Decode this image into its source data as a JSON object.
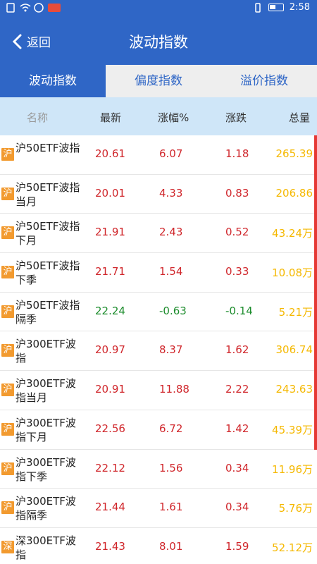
{
  "status_bar": {
    "time": "2:58"
  },
  "nav": {
    "back_label": "返回",
    "title": "波动指数"
  },
  "tabs": [
    {
      "label": "波动指数",
      "active": true
    },
    {
      "label": "偏度指数",
      "active": false
    },
    {
      "label": "溢价指数",
      "active": false
    }
  ],
  "table": {
    "headers": {
      "name": "名称",
      "latest": "最新",
      "pct": "涨幅%",
      "change": "涨跌",
      "volume": "总量"
    },
    "rows": [
      {
        "tag": "沪",
        "name": "沪50ETF波指",
        "latest": "20.61",
        "pct": "6.07",
        "change": "1.18",
        "volume": "265.39",
        "dir": "up"
      },
      {
        "tag": "沪",
        "name": "沪50ETF波指当月",
        "latest": "20.01",
        "pct": "4.33",
        "change": "0.83",
        "volume": "206.86",
        "dir": "up"
      },
      {
        "tag": "沪",
        "name": "沪50ETF波指下月",
        "latest": "21.91",
        "pct": "2.43",
        "change": "0.52",
        "volume": "43.24万",
        "dir": "up"
      },
      {
        "tag": "沪",
        "name": "沪50ETF波指下季",
        "latest": "21.71",
        "pct": "1.54",
        "change": "0.33",
        "volume": "10.08万",
        "dir": "up"
      },
      {
        "tag": "沪",
        "name": "沪50ETF波指隔季",
        "latest": "22.24",
        "pct": "-0.63",
        "change": "-0.14",
        "volume": "5.21万",
        "dir": "down"
      },
      {
        "tag": "沪",
        "name": "沪300ETF波指",
        "latest": "20.97",
        "pct": "8.37",
        "change": "1.62",
        "volume": "306.74",
        "dir": "up"
      },
      {
        "tag": "沪",
        "name": "沪300ETF波指当月",
        "latest": "20.91",
        "pct": "11.88",
        "change": "2.22",
        "volume": "243.63",
        "dir": "up"
      },
      {
        "tag": "沪",
        "name": "沪300ETF波指下月",
        "latest": "22.56",
        "pct": "6.72",
        "change": "1.42",
        "volume": "45.39万",
        "dir": "up"
      },
      {
        "tag": "沪",
        "name": "沪300ETF波指下季",
        "latest": "22.12",
        "pct": "1.56",
        "change": "0.34",
        "volume": "11.96万",
        "dir": "up"
      },
      {
        "tag": "沪",
        "name": "沪300ETF波指隔季",
        "latest": "21.44",
        "pct": "1.61",
        "change": "0.34",
        "volume": "5.76万",
        "dir": "up"
      },
      {
        "tag": "深",
        "name": "深300ETF波指",
        "latest": "21.43",
        "pct": "8.01",
        "change": "1.59",
        "volume": "52.12万",
        "dir": "up"
      }
    ]
  },
  "colors": {
    "primary": "#2f66c6",
    "up": "#d0272c",
    "down": "#1c8c2c",
    "volume": "#f5b800",
    "tag": "#f29a2f",
    "header_bg": "#cfe6f8"
  }
}
